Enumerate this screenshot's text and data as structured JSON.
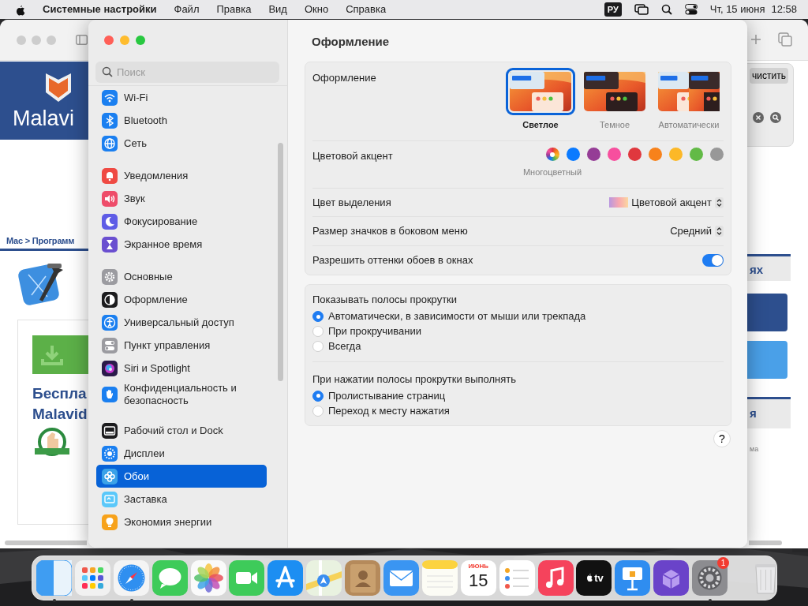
{
  "menu_bar": {
    "app_name": "Системные настройки",
    "menus": [
      "Файл",
      "Правка",
      "Вид",
      "Окно",
      "Справка"
    ],
    "input_source": "РУ",
    "date": "Чт, 15 июня",
    "time": "12:58"
  },
  "browser": {
    "logo_text": "Malavi",
    "breadcrumb": "Mac > Программ",
    "download_title": [
      "Беспла",
      "Malavid"
    ],
    "clear_button": "чистить",
    "side_headings": [
      "ях",
      "я"
    ],
    "side_note": "ма"
  },
  "settings": {
    "title": "Оформление",
    "search": {
      "placeholder": "Поиск"
    },
    "sidebar": {
      "groups": [
        {
          "items": [
            {
              "label": "Wi-Fi",
              "selected": false
            },
            {
              "label": "Bluetooth",
              "selected": false
            },
            {
              "label": "Сеть",
              "selected": false
            }
          ]
        },
        {
          "items": [
            {
              "label": "Уведомления",
              "selected": false
            },
            {
              "label": "Звук",
              "selected": false
            },
            {
              "label": "Фокусирование",
              "selected": false
            },
            {
              "label": "Экранное время",
              "selected": false
            }
          ]
        },
        {
          "items": [
            {
              "label": "Основные",
              "selected": false
            },
            {
              "label": "Оформление",
              "selected": false
            },
            {
              "label": "Универсальный доступ",
              "selected": false
            },
            {
              "label": "Пункт управления",
              "selected": false
            },
            {
              "label": "Siri и Spotlight",
              "selected": false
            },
            {
              "label": "Конфиденциальность и безопасность",
              "selected": false
            }
          ]
        },
        {
          "items": [
            {
              "label": "Рабочий стол и Dock",
              "selected": false
            },
            {
              "label": "Дисплеи",
              "selected": false
            },
            {
              "label": "Обои",
              "selected": true
            },
            {
              "label": "Заставка",
              "selected": false
            },
            {
              "label": "Экономия энергии",
              "selected": false
            }
          ]
        }
      ]
    },
    "appearance": {
      "label": "Оформление",
      "options": [
        {
          "kind": "light",
          "label": "Светлое",
          "selected": true
        },
        {
          "kind": "dark",
          "label": "Темное",
          "selected": false
        },
        {
          "kind": "auto",
          "label": "Автоматически",
          "selected": false
        }
      ]
    },
    "accent": {
      "label": "Цветовой акцент",
      "caption": "Многоцветный",
      "colors": [
        {
          "kind": "multicolor",
          "selected": true
        },
        {
          "kind": "solid",
          "color": "#0a7aff",
          "selected": false
        },
        {
          "kind": "solid",
          "color": "#953d96",
          "selected": false
        },
        {
          "kind": "solid",
          "color": "#f74f9e",
          "selected": false
        },
        {
          "kind": "solid",
          "color": "#e0383e",
          "selected": false
        },
        {
          "kind": "solid",
          "color": "#f7821b",
          "selected": false
        },
        {
          "kind": "solid",
          "color": "#fcb827",
          "selected": false
        },
        {
          "kind": "solid",
          "color": "#62ba46",
          "selected": false
        },
        {
          "kind": "solid",
          "color": "#989898",
          "selected": false
        }
      ]
    },
    "highlight": {
      "label": "Цвет выделения",
      "value": "Цветовой акцент"
    },
    "icon_size": {
      "label": "Размер значков в боковом меню",
      "value": "Средний"
    },
    "wallpaper_tint": {
      "label": "Разрешить оттенки обоев в окнах",
      "on": true
    },
    "scroll_bars": {
      "label": "Показывать полосы прокрутки",
      "options": [
        {
          "label": "Автоматически, в зависимости от мыши или трекпада",
          "selected": true
        },
        {
          "label": "При прокручивании",
          "selected": false
        },
        {
          "label": "Всегда",
          "selected": false
        }
      ]
    },
    "click_scroll": {
      "label": "При нажатии полосы прокрутки выполнять",
      "options": [
        {
          "label": "Пролистывание страниц",
          "selected": true
        },
        {
          "label": "Переход к месту нажатия",
          "selected": false
        }
      ]
    },
    "help_button": "?"
  },
  "dock": {
    "items": [
      {
        "kind": "finder",
        "running": true
      },
      {
        "kind": "launchpad",
        "running": false
      },
      {
        "kind": "safari",
        "running": true
      },
      {
        "kind": "messages",
        "running": false
      },
      {
        "kind": "photos",
        "running": false
      },
      {
        "kind": "facetime",
        "running": false
      },
      {
        "kind": "appstore",
        "running": false
      },
      {
        "kind": "maps",
        "running": false
      },
      {
        "kind": "contacts",
        "running": false
      },
      {
        "kind": "mail",
        "running": false
      },
      {
        "kind": "notes",
        "running": false
      },
      {
        "kind": "calendar",
        "month": "ИЮНЬ",
        "day": "15",
        "running": false
      },
      {
        "kind": "reminders",
        "running": false
      },
      {
        "kind": "music",
        "running": false
      },
      {
        "kind": "tv",
        "label": "tv",
        "running": false
      },
      {
        "kind": "keynote",
        "running": false
      },
      {
        "kind": "box",
        "running": false
      },
      {
        "kind": "settings",
        "badge": "1",
        "running": true
      },
      {
        "kind": "trash",
        "running": false
      }
    ]
  }
}
